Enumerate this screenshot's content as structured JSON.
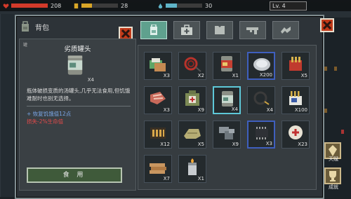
{
  "status": {
    "hp": "208",
    "food": "28",
    "water": "30",
    "level": "Lv. 4"
  },
  "colors": {
    "hp": "#d23a2a",
    "food": "#d9a627",
    "water": "#5fb4c8",
    "selected_border": "#5ec8d8",
    "active_tab": "#5fa18e",
    "close_button": "#c13a1a"
  },
  "bag": {
    "title": "背包",
    "close_icon": "close-icon"
  },
  "detail": {
    "corner_label": "罐",
    "name": "劣质罐头",
    "quantity": "X4",
    "description": "瓶体破损变质的汤罐头,几乎无法食用,但饥饿难耐时也别无选择。",
    "effect_good": "+ 恢复饥饿值12点",
    "effect_bad": "损失-2%生命值",
    "use_button": "食 用"
  },
  "tabs": [
    {
      "icon": "backpack-icon",
      "active": true
    },
    {
      "icon": "medkit-icon",
      "active": false
    },
    {
      "icon": "armor-icon",
      "active": false
    },
    {
      "icon": "gun-icon",
      "active": false
    },
    {
      "icon": "parts-icon",
      "active": false
    }
  ],
  "items": [
    {
      "name": "bandage-stack",
      "qty": "X3",
      "icon": "bandage-icon"
    },
    {
      "name": "rope-coil",
      "qty": "X2",
      "icon": "rope-icon"
    },
    {
      "name": "canned-food",
      "qty": "X1",
      "icon": "can-icon"
    },
    {
      "name": "silver-coin",
      "qty": "X200",
      "icon": "coin-icon"
    },
    {
      "name": "ammo-box",
      "qty": "X5",
      "icon": "ammo-box-icon"
    },
    {
      "name": "meat-slab",
      "qty": "X3",
      "icon": "meat-icon"
    },
    {
      "name": "first-aid-bag",
      "qty": "X9",
      "icon": "aid-bag-icon"
    },
    {
      "name": "poor-canned-food",
      "qty": "X4",
      "icon": "can-icon"
    },
    {
      "name": "cable-coil",
      "qty": "X4",
      "icon": "cable-icon"
    },
    {
      "name": "bullets-crate",
      "qty": "X100",
      "icon": "bullet-crate-icon"
    },
    {
      "name": "shotgun-shells",
      "qty": "X12",
      "icon": "shells-icon"
    },
    {
      "name": "cloth-bundle",
      "qty": "X5",
      "icon": "cloth-icon"
    },
    {
      "name": "steel-pipe",
      "qty": "X9",
      "icon": "pipe-icon"
    },
    {
      "name": "electronic-chip",
      "qty": "X3",
      "icon": "chip-icon"
    },
    {
      "name": "medicine-pack",
      "qty": "X23",
      "icon": "medicine-icon"
    },
    {
      "name": "wood-planks",
      "qty": "X7",
      "icon": "wood-icon"
    },
    {
      "name": "lighter",
      "qty": "X1",
      "icon": "lighter-icon"
    }
  ],
  "side": {
    "talent": "天赋",
    "achievement": "成就"
  }
}
